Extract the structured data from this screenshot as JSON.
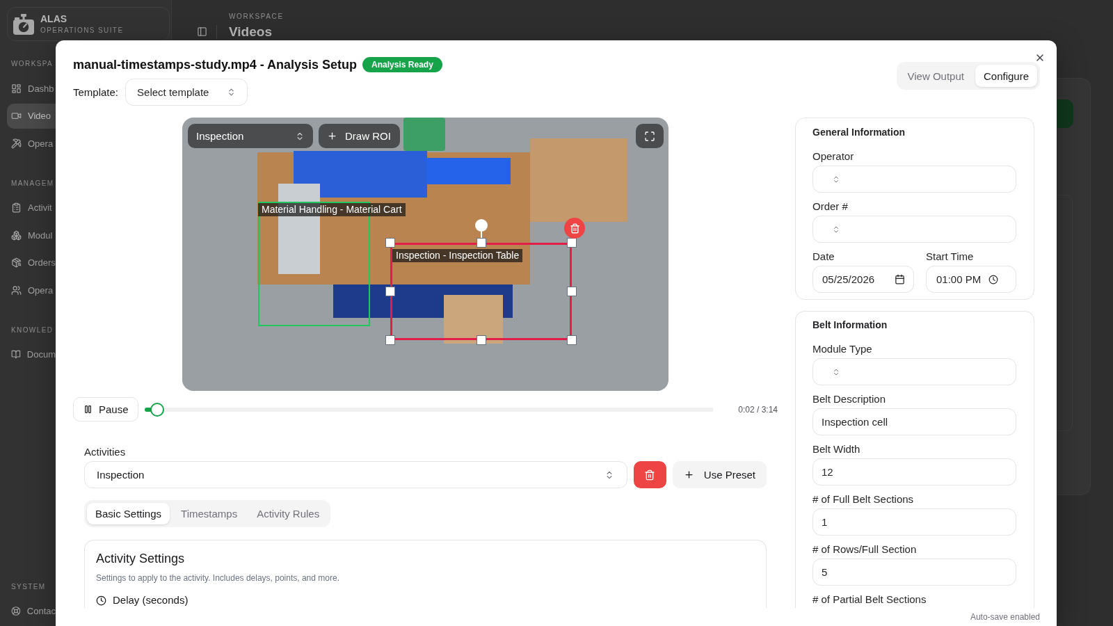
{
  "background": {
    "sidebar": {
      "brand": {
        "name": "ALAS",
        "tagline": "OPERATIONS SUITE"
      },
      "sections": [
        {
          "label": "WORKSPA",
          "items": [
            {
              "label": "Dashb",
              "selected": false
            },
            {
              "label": "Video",
              "selected": true
            },
            {
              "label": "Opera",
              "selected": false
            }
          ]
        },
        {
          "label": "MANAGEM",
          "items": [
            {
              "label": "Activit",
              "selected": false
            },
            {
              "label": "Modul",
              "selected": false
            },
            {
              "label": "Orders",
              "selected": false
            },
            {
              "label": "Opera",
              "selected": false
            }
          ]
        },
        {
          "label": "KNOWLED",
          "items": [
            {
              "label": "Docum",
              "selected": false
            }
          ]
        },
        {
          "label": "SYSTEM",
          "items": [
            {
              "label": "Contac",
              "selected": false
            }
          ]
        }
      ]
    },
    "header": {
      "eyebrow": "WORKSPACE",
      "title": "Videos"
    }
  },
  "dialog": {
    "title": "manual-timestamps-study.mp4 - Analysis Setup",
    "status": "Analysis Ready",
    "template": {
      "label": "Template:",
      "placeholder": "Select template"
    },
    "view_tabs": [
      {
        "label": "View Output",
        "selected": false
      },
      {
        "label": "Configure",
        "selected": true
      }
    ],
    "video": {
      "activity": "Inspection",
      "draw_button": "Draw ROI",
      "regions": [
        {
          "label": "Material Handling - Material Cart",
          "color": "#22c55e",
          "selected": false
        },
        {
          "label": "Inspection - Inspection Table",
          "color": "#e11d48",
          "selected": true
        }
      ]
    },
    "playback": {
      "button": "Pause",
      "level": 0.01,
      "time": "0:02 / 3:14"
    },
    "activities": {
      "label": "Activities",
      "value": "Inspection",
      "preset_button": "Use Preset"
    },
    "settings_tabs": [
      {
        "label": "Basic Settings",
        "selected": true
      },
      {
        "label": "Timestamps",
        "selected": false
      },
      {
        "label": "Activity Rules",
        "selected": false
      }
    ],
    "activity_settings": {
      "title": "Activity Settings",
      "description": "Settings to apply to the activity. Includes delays, points, and more.",
      "fields": [
        {
          "label": "Delay (seconds)"
        }
      ]
    },
    "general_information": {
      "title": "General Information",
      "fields": [
        {
          "kind": "select",
          "label": "Operator"
        },
        {
          "kind": "select",
          "label": "Order #"
        },
        {
          "kind": "date",
          "label": "Date",
          "value": "05/25/2026"
        },
        {
          "kind": "time",
          "label": "Start Time",
          "value": "01:00 PM"
        }
      ]
    },
    "belt_information": {
      "title": "Belt Information",
      "fields": [
        {
          "kind": "select",
          "label": "Module Type"
        },
        {
          "kind": "text",
          "label": "Belt Description",
          "value": "Inspection cell"
        },
        {
          "kind": "text",
          "label": "Belt Width",
          "value": "12"
        },
        {
          "kind": "text",
          "label": "# of Full Belt Sections",
          "value": "1"
        },
        {
          "kind": "text",
          "label": "# of Rows/Full Section",
          "value": "5"
        },
        {
          "kind": "label",
          "label": "# of Partial Belt Sections"
        }
      ]
    },
    "footer": {
      "note": "Auto-save enabled"
    }
  }
}
